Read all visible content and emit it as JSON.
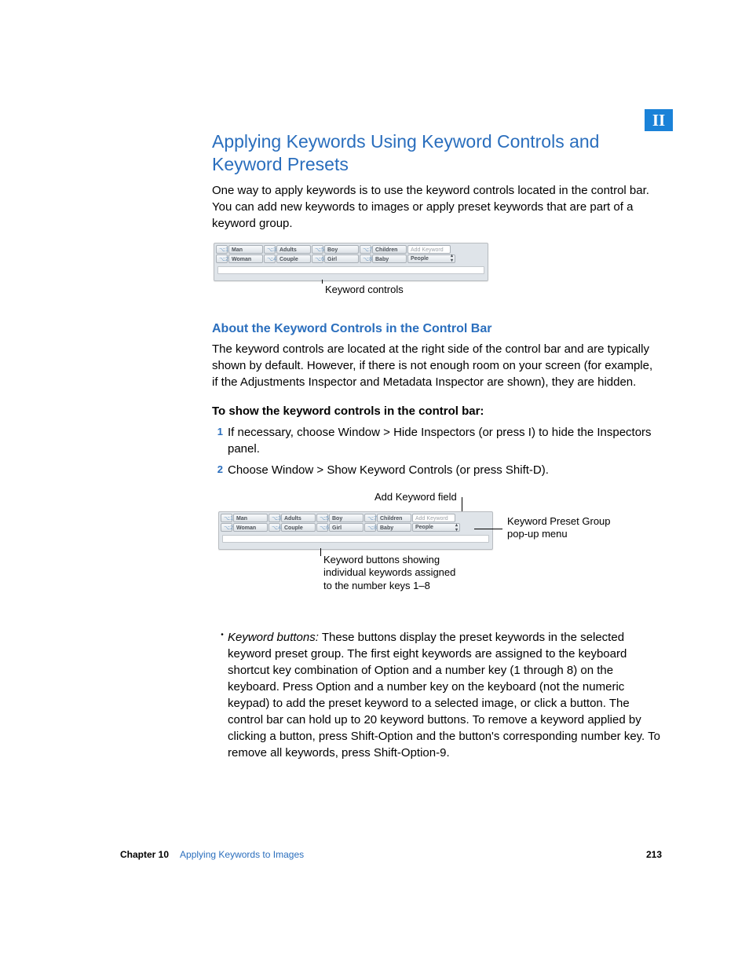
{
  "part_label": "II",
  "section": {
    "title": "Applying Keywords Using Keyword Controls and Keyword Presets",
    "intro": "One way to apply keywords is to use the keyword controls located in the control bar. You can add new keywords to images or apply preset keywords that are part of a keyword group."
  },
  "keyword_panel": {
    "row1_tags": [
      "⌥1",
      "⌥3",
      "⌥5",
      "⌥7"
    ],
    "row1_labels": [
      "Man",
      "Adults",
      "Boy",
      "Children"
    ],
    "row2_tags": [
      "⌥2",
      "⌥4",
      "⌥6",
      "⌥8"
    ],
    "row2_labels": [
      "Woman",
      "Couple",
      "Girl",
      "Baby"
    ],
    "add_placeholder": "Add Keyword",
    "preset_group": "People"
  },
  "fig1_caption": "Keyword controls",
  "subsection": {
    "title": "About the Keyword Controls in the Control Bar",
    "body": "The keyword controls are located at the right side of the control bar and are typically shown by default. However, if there is not enough room on your screen (for example, if the Adjustments Inspector and Metadata Inspector are shown), they are hidden.",
    "instruction_head": "To show the keyword controls in the control bar:",
    "steps": [
      "If necessary, choose Window > Hide Inspectors (or press I) to hide the Inspectors panel.",
      "Choose Window > Show Keyword Controls (or press Shift-D)."
    ]
  },
  "fig2_callouts": {
    "top": "Add Keyword field",
    "right_l1": "Keyword Preset Group",
    "right_l2": "pop-up menu",
    "bottom_l1": "Keyword buttons showing",
    "bottom_l2": "individual keywords assigned",
    "bottom_l3": "to the number keys 1–8"
  },
  "bullet": {
    "term": "Keyword buttons:",
    "body": "These buttons display the preset keywords in the selected keyword preset group. The first eight keywords are assigned to the keyboard shortcut key combination of Option and a number key (1 through 8) on the keyboard. Press Option and a number key on the keyboard (not the numeric keypad) to add the preset keyword to a selected image, or click a button. The control bar can hold up to 20 keyword buttons. To remove a keyword applied by clicking a button, press Shift-Option and the button's corresponding number key. To remove all keywords, press Shift-Option-9."
  },
  "footer": {
    "chapter": "Chapter 10",
    "chapter_title": "Applying Keywords to Images",
    "page": "213"
  }
}
